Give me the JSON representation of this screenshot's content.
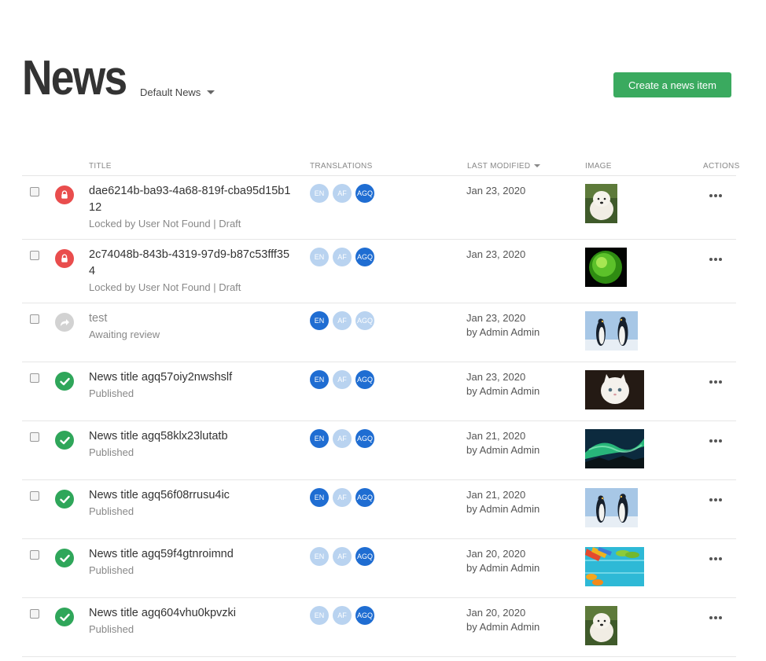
{
  "header": {
    "title": "News",
    "channel_label": "Default News",
    "create_button": "Create a news item"
  },
  "table": {
    "columns": {
      "title": "TITLE",
      "translations": "TRANSLATIONS",
      "last_modified": "LAST MODIFIED",
      "image": "IMAGE",
      "actions": "ACTIONS"
    },
    "rows": [
      {
        "title": "dae6214b-ba93-4a68-819f-cba95d15b112",
        "subtitle": "Locked by User Not Found | Draft",
        "status": "locked",
        "status_icon": "lock-icon",
        "translations": [
          {
            "code": "EN",
            "active": false
          },
          {
            "code": "AF",
            "active": false
          },
          {
            "code": "AGQ",
            "active": true
          }
        ],
        "date": "Jan 23, 2020",
        "author": "",
        "image": "puppy",
        "has_actions": true
      },
      {
        "title": "2c74048b-843b-4319-97d9-b87c53fff354",
        "subtitle": "Locked by User Not Found | Draft",
        "status": "locked",
        "status_icon": "lock-icon",
        "translations": [
          {
            "code": "EN",
            "active": false
          },
          {
            "code": "AF",
            "active": false
          },
          {
            "code": "AGQ",
            "active": true
          }
        ],
        "date": "Jan 23, 2020",
        "author": "",
        "image": "sun",
        "has_actions": true
      },
      {
        "title": "test",
        "subtitle": "Awaiting review",
        "status": "review",
        "status_icon": "share-arrow-icon",
        "translations": [
          {
            "code": "EN",
            "active": true
          },
          {
            "code": "AF",
            "active": false
          },
          {
            "code": "AGQ",
            "active": false
          }
        ],
        "date": "Jan 23, 2020",
        "author": "by Admin Admin",
        "image": "penguins",
        "has_actions": false
      },
      {
        "title": "News title agq57oiy2nwshslf",
        "subtitle": "Published",
        "status": "published",
        "status_icon": "check-icon",
        "translations": [
          {
            "code": "EN",
            "active": true
          },
          {
            "code": "AF",
            "active": false
          },
          {
            "code": "AGQ",
            "active": true
          }
        ],
        "date": "Jan 23, 2020",
        "author": "by Admin Admin",
        "image": "kitten",
        "has_actions": true
      },
      {
        "title": "News title agq58klx23lutatb",
        "subtitle": "Published",
        "status": "published",
        "status_icon": "check-icon",
        "translations": [
          {
            "code": "EN",
            "active": true
          },
          {
            "code": "AF",
            "active": false
          },
          {
            "code": "AGQ",
            "active": true
          }
        ],
        "date": "Jan 21, 2020",
        "author": "by Admin Admin",
        "image": "aurora",
        "has_actions": true
      },
      {
        "title": "News title agq56f08rrusu4ic",
        "subtitle": "Published",
        "status": "published",
        "status_icon": "check-icon",
        "translations": [
          {
            "code": "EN",
            "active": true
          },
          {
            "code": "AF",
            "active": false
          },
          {
            "code": "AGQ",
            "active": true
          }
        ],
        "date": "Jan 21, 2020",
        "author": "by Admin Admin",
        "image": "penguins",
        "has_actions": true
      },
      {
        "title": "News title agq59f4gtnroimnd",
        "subtitle": "Published",
        "status": "published",
        "status_icon": "check-icon",
        "translations": [
          {
            "code": "EN",
            "active": false
          },
          {
            "code": "AF",
            "active": false
          },
          {
            "code": "AGQ",
            "active": true
          }
        ],
        "date": "Jan 20, 2020",
        "author": "by Admin Admin",
        "image": "beach",
        "has_actions": true
      },
      {
        "title": "News title agq604vhu0kpvzki",
        "subtitle": "Published",
        "status": "published",
        "status_icon": "check-icon",
        "translations": [
          {
            "code": "EN",
            "active": false
          },
          {
            "code": "AF",
            "active": false
          },
          {
            "code": "AGQ",
            "active": true
          }
        ],
        "date": "Jan 20, 2020",
        "author": "by Admin Admin",
        "image": "puppy",
        "has_actions": true
      }
    ]
  },
  "colors": {
    "primary_button": "#3aaa5f",
    "published": "#2fa65a",
    "locked": "#e94d4d",
    "review": "#d2d2d2",
    "translation_active": "#1f6dd2",
    "translation_inactive": "#b9d3f0"
  }
}
